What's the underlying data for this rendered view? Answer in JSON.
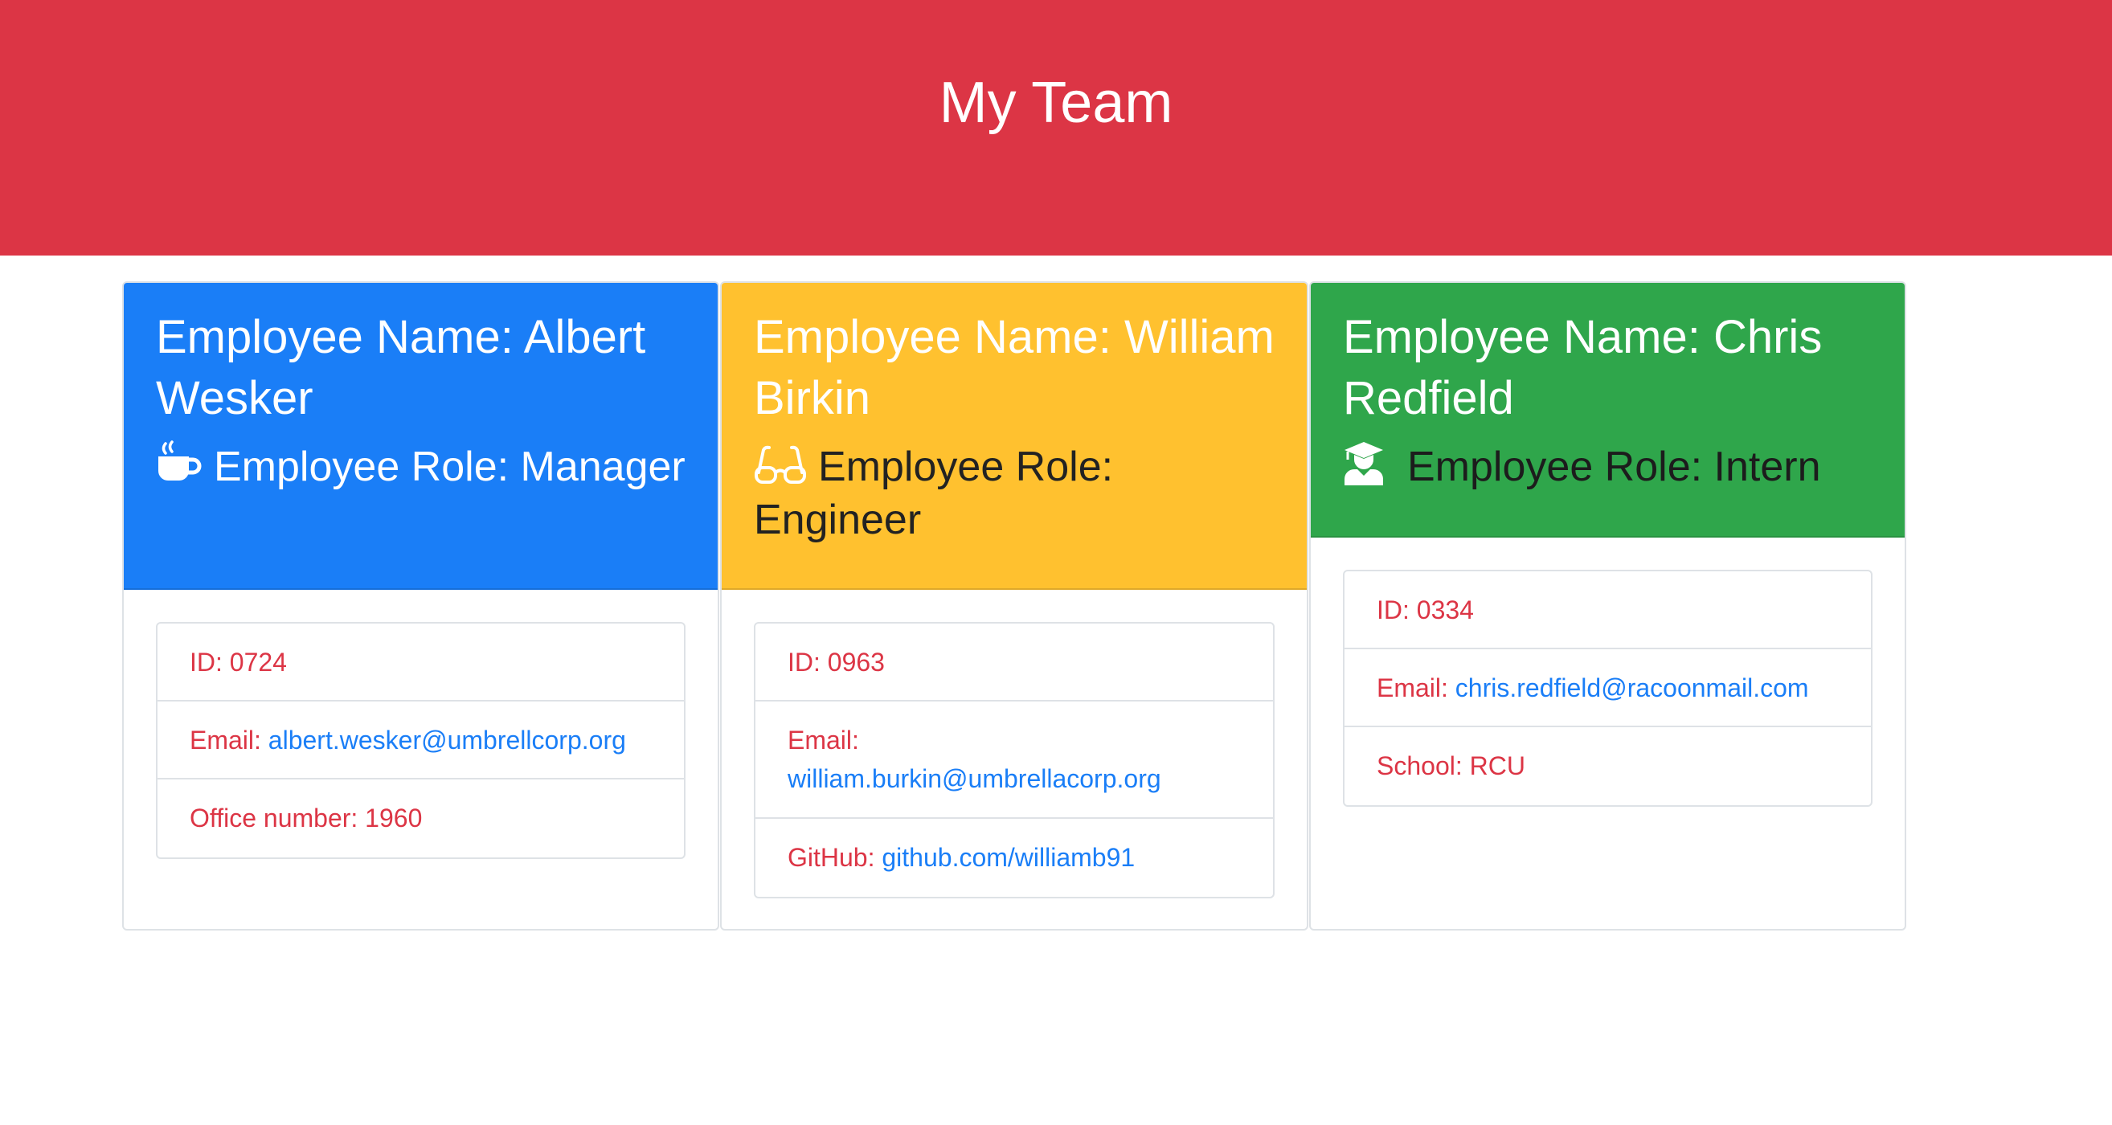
{
  "header": {
    "title": "My Team"
  },
  "employees": [
    {
      "name": "Employee Name: Albert Wesker",
      "role": "Employee Role: Manager",
      "role_icon": "coffee-icon",
      "id": "ID: 0724",
      "email_label": "Email:",
      "email": "albert.wesker@umbrellcorp.org",
      "extra_label": "Office number: 1960",
      "extra_link": ""
    },
    {
      "name": "Employee Name: William Birkin",
      "role": "Employee Role: Engineer",
      "role_icon": "glasses-icon",
      "id": "ID: 0963",
      "email_label": "Email:",
      "email": "william.burkin@umbrellacorp.org",
      "extra_label": "GitHub:",
      "extra_link": "github.com/williamb91"
    },
    {
      "name": "Employee Name: Chris Redfield",
      "role": "Employee Role: Intern",
      "role_icon": "graduate-icon",
      "id": "ID: 0334",
      "email_label": "Email:",
      "email": "chris.redfield@racoonmail.com",
      "extra_label": "School: RCU",
      "extra_link": ""
    }
  ],
  "colors": {
    "jumbotron": "#dc3545",
    "manager": "#1a7ef7",
    "engineer": "#ffc12f",
    "intern": "#2fa64b",
    "link": "#1a7ef7",
    "list_text": "#dc3545"
  }
}
